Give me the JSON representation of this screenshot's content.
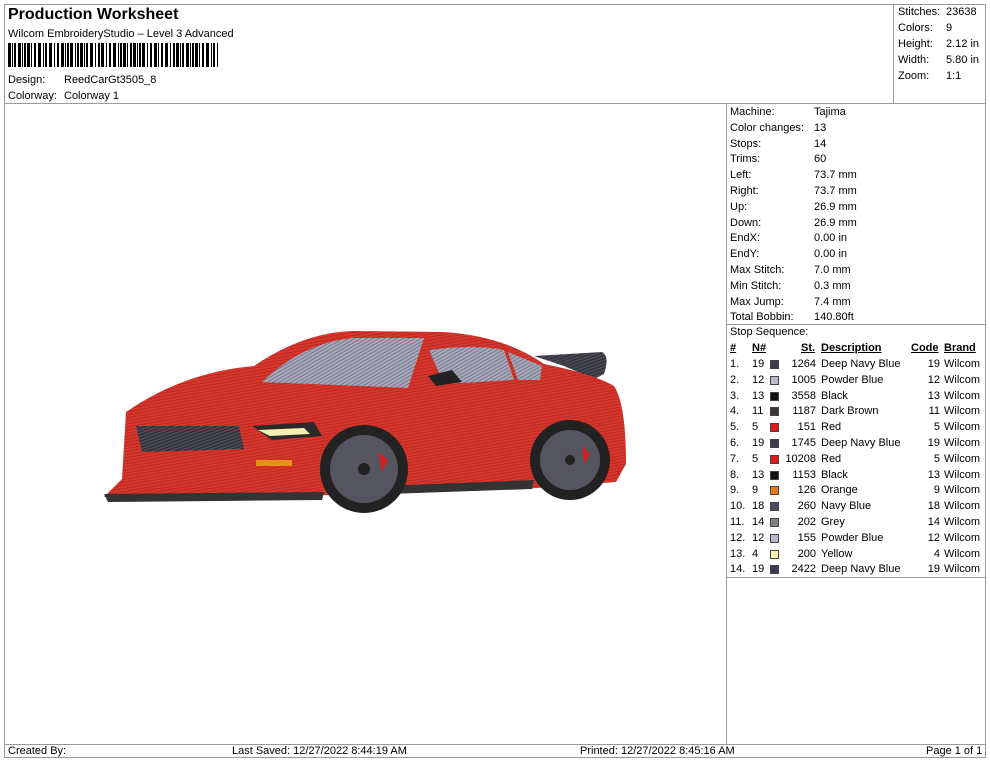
{
  "header": {
    "title": "Production Worksheet",
    "subtitle": "Wilcom EmbroideryStudio – Level 3 Advanced",
    "design_label": "Design:",
    "design_value": "ReedCarGt3505_8",
    "colorway_label": "Colorway:",
    "colorway_value": "Colorway 1"
  },
  "stats": [
    {
      "label": "Stitches:",
      "value": "23638"
    },
    {
      "label": "Colors:",
      "value": "9"
    },
    {
      "label": "Height:",
      "value": "2.12 in"
    },
    {
      "label": "Width:",
      "value": "5.80 in"
    },
    {
      "label": "Zoom:",
      "value": "1:1"
    }
  ],
  "machine_info": [
    {
      "label": "Machine:",
      "value": "Tajima"
    },
    {
      "label": "Color changes:",
      "value": "13"
    },
    {
      "label": "Stops:",
      "value": "14"
    },
    {
      "label": "Trims:",
      "value": "60"
    },
    {
      "label": "Left:",
      "value": "73.7 mm"
    },
    {
      "label": "Right:",
      "value": "73.7 mm"
    },
    {
      "label": "Up:",
      "value": "26.9 mm"
    },
    {
      "label": "Down:",
      "value": "26.9 mm"
    },
    {
      "label": "EndX:",
      "value": "0.00 in"
    },
    {
      "label": "EndY:",
      "value": "0.00 in"
    },
    {
      "label": "Max Stitch:",
      "value": "7.0 mm"
    },
    {
      "label": "Min Stitch:",
      "value": "0.3 mm"
    },
    {
      "label": "Max Jump:",
      "value": "7.4 mm"
    },
    {
      "label": "Total Bobbin:",
      "value": "140.80ft"
    }
  ],
  "stop_sequence": {
    "title": "Stop Sequence:",
    "columns": {
      "num": "#",
      "needle": "N#",
      "stitches": "St.",
      "description": "Description",
      "code": "Code",
      "brand": "Brand"
    },
    "rows": [
      {
        "num": "1.",
        "needle": "19",
        "color": "#3a3a50",
        "stitches": "1264",
        "description": "Deep Navy Blue",
        "code": "19",
        "brand": "Wilcom"
      },
      {
        "num": "2.",
        "needle": "12",
        "color": "#b8b8d0",
        "stitches": "1005",
        "description": "Powder Blue",
        "code": "12",
        "brand": "Wilcom"
      },
      {
        "num": "3.",
        "needle": "13",
        "color": "#111111",
        "stitches": "3558",
        "description": "Black",
        "code": "13",
        "brand": "Wilcom"
      },
      {
        "num": "4.",
        "needle": "11",
        "color": "#3b3535",
        "stitches": "1187",
        "description": "Dark Brown",
        "code": "11",
        "brand": "Wilcom"
      },
      {
        "num": "5.",
        "needle": "5",
        "color": "#dd1c1c",
        "stitches": "151",
        "description": "Red",
        "code": "5",
        "brand": "Wilcom"
      },
      {
        "num": "6.",
        "needle": "19",
        "color": "#3a3a50",
        "stitches": "1745",
        "description": "Deep Navy Blue",
        "code": "19",
        "brand": "Wilcom"
      },
      {
        "num": "7.",
        "needle": "5",
        "color": "#dd1c1c",
        "stitches": "10208",
        "description": "Red",
        "code": "5",
        "brand": "Wilcom"
      },
      {
        "num": "8.",
        "needle": "13",
        "color": "#111111",
        "stitches": "1153",
        "description": "Black",
        "code": "13",
        "brand": "Wilcom"
      },
      {
        "num": "9.",
        "needle": "9",
        "color": "#e87a18",
        "stitches": "126",
        "description": "Orange",
        "code": "9",
        "brand": "Wilcom"
      },
      {
        "num": "10.",
        "needle": "18",
        "color": "#4a4a66",
        "stitches": "260",
        "description": "Navy Blue",
        "code": "18",
        "brand": "Wilcom"
      },
      {
        "num": "11.",
        "needle": "14",
        "color": "#808080",
        "stitches": "202",
        "description": "Grey",
        "code": "14",
        "brand": "Wilcom"
      },
      {
        "num": "12.",
        "needle": "12",
        "color": "#b8b8d0",
        "stitches": "155",
        "description": "Powder Blue",
        "code": "12",
        "brand": "Wilcom"
      },
      {
        "num": "13.",
        "needle": "4",
        "color": "#f8f4b0",
        "stitches": "200",
        "description": "Yellow",
        "code": "4",
        "brand": "Wilcom"
      },
      {
        "num": "14.",
        "needle": "19",
        "color": "#3a3a50",
        "stitches": "2422",
        "description": "Deep Navy Blue",
        "code": "19",
        "brand": "Wilcom"
      }
    ]
  },
  "footer": {
    "created_by": "Created By:",
    "last_saved": "Last Saved: 12/27/2022 8:44:19 AM",
    "printed": "Printed: 12/27/2022 8:45:16 AM",
    "page": "Page 1 of 1"
  }
}
